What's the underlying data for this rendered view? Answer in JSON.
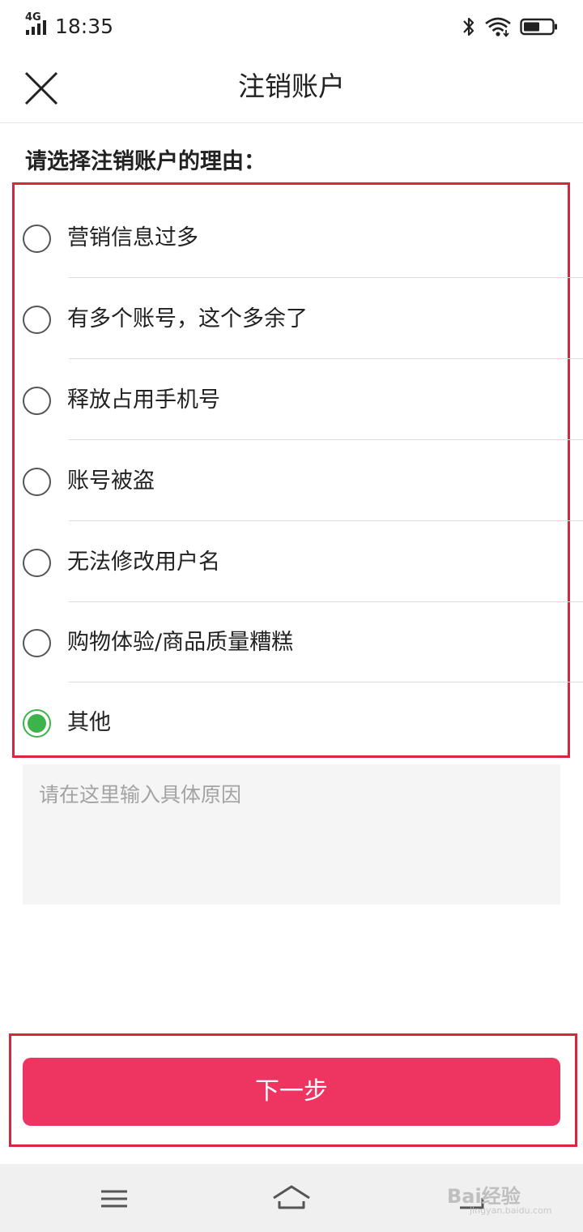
{
  "status_bar": {
    "network": "4G",
    "time": "18:35"
  },
  "header": {
    "title": "注销账户"
  },
  "section_title": "请选择注销账户的理由：",
  "options": [
    {
      "label": "营销信息过多",
      "selected": false
    },
    {
      "label": "有多个账号，这个多余了",
      "selected": false
    },
    {
      "label": "释放占用手机号",
      "selected": false
    },
    {
      "label": "账号被盗",
      "selected": false
    },
    {
      "label": "无法修改用户名",
      "selected": false
    },
    {
      "label": "购物体验/商品质量糟糕",
      "selected": false
    },
    {
      "label": "其他",
      "selected": true
    }
  ],
  "reason_input": {
    "placeholder": "请在这里输入具体原因",
    "value": ""
  },
  "next_button": {
    "label": "下一步"
  },
  "colors": {
    "accent": "#ee3561",
    "selected": "#3cb44a",
    "highlight_border": "#d7263d"
  },
  "watermark": {
    "brand": "Bai经验",
    "url": "jingyan.baidu.com"
  }
}
